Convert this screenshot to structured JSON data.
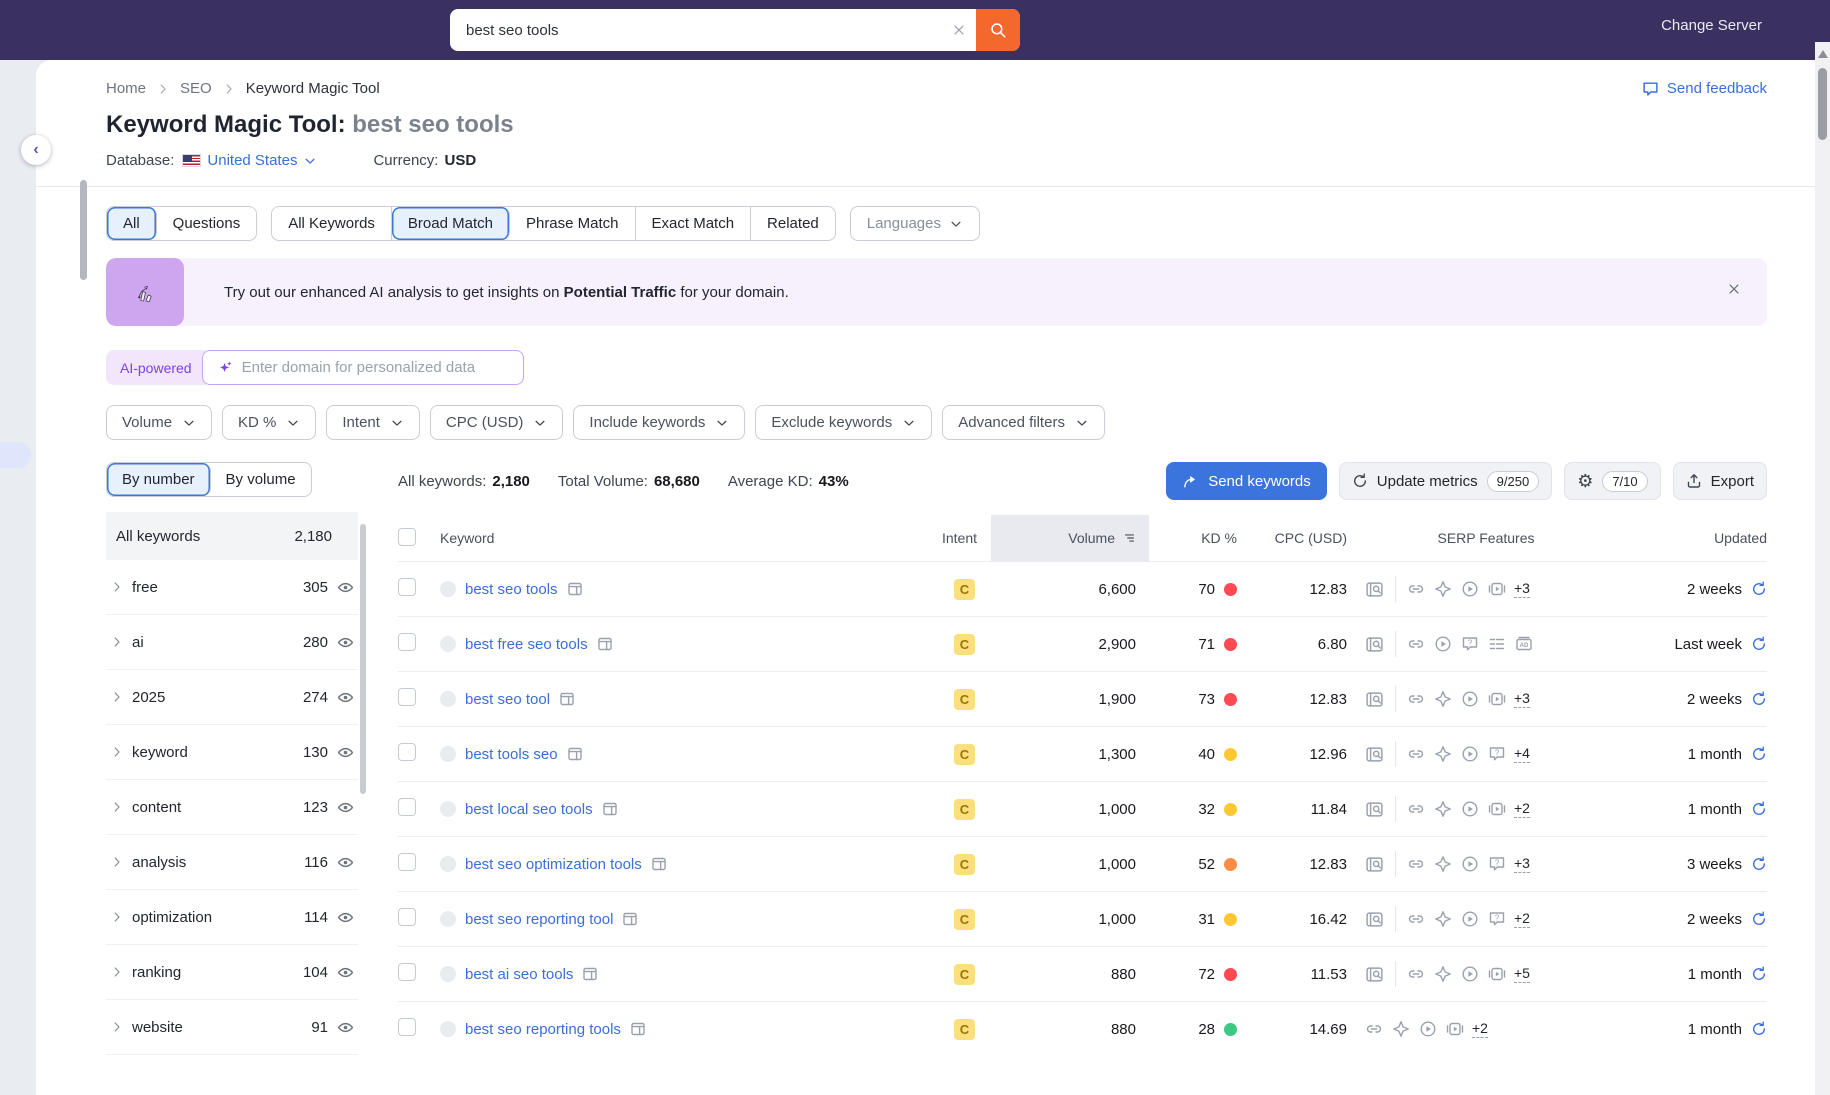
{
  "topbar": {
    "search_value": "best seo tools",
    "change_server": "Change Server"
  },
  "header": {
    "breadcrumb": [
      "Home",
      "SEO",
      "Keyword Magic Tool"
    ],
    "send_feedback": "Send feedback",
    "title": "Keyword Magic Tool:",
    "query": "best seo tools",
    "database_label": "Database:",
    "database_value": "United States",
    "currency_label": "Currency:",
    "currency_value": "USD"
  },
  "match_tabs": {
    "group1": [
      {
        "label": "All",
        "active": true
      },
      {
        "label": "Questions",
        "active": false
      }
    ],
    "group2": [
      {
        "label": "All Keywords",
        "active": false
      },
      {
        "label": "Broad Match",
        "active": true
      },
      {
        "label": "Phrase Match",
        "active": false
      },
      {
        "label": "Exact Match",
        "active": false
      },
      {
        "label": "Related",
        "active": false
      }
    ],
    "languages": "Languages"
  },
  "banner": {
    "text_before": "Try out our enhanced AI analysis to get insights on ",
    "text_bold": "Potential Traffic",
    "text_after": " for your domain."
  },
  "ai_bar": {
    "badge": "AI-powered",
    "placeholder": "Enter domain for personalized data"
  },
  "filters": [
    "Volume",
    "KD %",
    "Intent",
    "CPC (USD)",
    "Include keywords",
    "Exclude keywords",
    "Advanced filters"
  ],
  "sidebar": {
    "tabs": [
      {
        "label": "By number",
        "active": true
      },
      {
        "label": "By volume",
        "active": false
      }
    ],
    "all_label": "All keywords",
    "all_count": "2,180",
    "groups": [
      {
        "name": "free",
        "count": "305"
      },
      {
        "name": "ai",
        "count": "280"
      },
      {
        "name": "2025",
        "count": "274"
      },
      {
        "name": "keyword",
        "count": "130"
      },
      {
        "name": "content",
        "count": "123"
      },
      {
        "name": "analysis",
        "count": "116"
      },
      {
        "name": "optimization",
        "count": "114"
      },
      {
        "name": "ranking",
        "count": "104"
      },
      {
        "name": "website",
        "count": "91"
      }
    ]
  },
  "toolbar": {
    "stats": [
      {
        "label": "All keywords:",
        "value": "2,180"
      },
      {
        "label": "Total Volume:",
        "value": "68,680"
      },
      {
        "label": "Average KD:",
        "value": "43%"
      }
    ],
    "send_keywords": "Send keywords",
    "update_metrics": "Update metrics",
    "update_quota": "9/250",
    "settings_quota": "7/10",
    "export": "Export"
  },
  "table": {
    "columns": {
      "keyword": "Keyword",
      "intent": "Intent",
      "volume": "Volume",
      "kd": "KD %",
      "cpc": "CPC (USD)",
      "serp": "SERP Features",
      "updated": "Updated"
    },
    "rows": [
      {
        "keyword": "best seo tools",
        "intent": "C",
        "volume": "6,600",
        "kd": "70",
        "kd_level": "red",
        "cpc": "12.83",
        "has_preview": true,
        "serp_icons": [
          "link",
          "featured-snippet",
          "video",
          "video-carousel"
        ],
        "serp_more": "+3",
        "updated": "2 weeks"
      },
      {
        "keyword": "best free seo tools",
        "intent": "C",
        "volume": "2,900",
        "kd": "71",
        "kd_level": "red",
        "cpc": "6.80",
        "has_preview": true,
        "serp_icons": [
          "link",
          "video",
          "people-also-ask",
          "sitelinks",
          "ads"
        ],
        "serp_more": "",
        "updated": "Last week"
      },
      {
        "keyword": "best seo tool",
        "intent": "C",
        "volume": "1,900",
        "kd": "73",
        "kd_level": "red",
        "cpc": "12.83",
        "has_preview": true,
        "serp_icons": [
          "link",
          "featured-snippet",
          "video",
          "video-carousel"
        ],
        "serp_more": "+3",
        "updated": "2 weeks"
      },
      {
        "keyword": "best tools seo",
        "intent": "C",
        "volume": "1,300",
        "kd": "40",
        "kd_level": "yellow",
        "cpc": "12.96",
        "has_preview": true,
        "serp_icons": [
          "link",
          "featured-snippet",
          "video",
          "people-also-ask"
        ],
        "serp_more": "+4",
        "updated": "1 month"
      },
      {
        "keyword": "best local seo tools",
        "intent": "C",
        "volume": "1,000",
        "kd": "32",
        "kd_level": "yellow",
        "cpc": "11.84",
        "has_preview": true,
        "serp_icons": [
          "link",
          "featured-snippet",
          "video",
          "video-carousel"
        ],
        "serp_more": "+2",
        "updated": "1 month"
      },
      {
        "keyword": "best seo optimization tools",
        "intent": "C",
        "volume": "1,000",
        "kd": "52",
        "kd_level": "orange",
        "cpc": "12.83",
        "has_preview": true,
        "serp_icons": [
          "link",
          "featured-snippet",
          "video",
          "people-also-ask"
        ],
        "serp_more": "+3",
        "updated": "3 weeks"
      },
      {
        "keyword": "best seo reporting tool",
        "intent": "C",
        "volume": "1,000",
        "kd": "31",
        "kd_level": "yellow",
        "cpc": "16.42",
        "has_preview": true,
        "serp_icons": [
          "link",
          "featured-snippet",
          "video",
          "people-also-ask"
        ],
        "serp_more": "+2",
        "updated": "2 weeks"
      },
      {
        "keyword": "best ai seo tools",
        "intent": "C",
        "volume": "880",
        "kd": "72",
        "kd_level": "red",
        "cpc": "11.53",
        "has_preview": true,
        "serp_icons": [
          "link",
          "featured-snippet",
          "video",
          "video-carousel"
        ],
        "serp_more": "+5",
        "updated": "1 month"
      },
      {
        "keyword": "best seo reporting tools",
        "intent": "C",
        "volume": "880",
        "kd": "28",
        "kd_level": "green",
        "cpc": "14.69",
        "has_preview": false,
        "serp_icons": [
          "link",
          "featured-snippet",
          "video",
          "video-carousel"
        ],
        "serp_more": "+2",
        "updated": "1 month"
      }
    ]
  },
  "colors": {
    "topbar_bg": "#3a3160",
    "brand_orange": "#f4682d",
    "accent_blue": "#3a74dc",
    "link_blue": "#3a6fd8",
    "ai_purple": "#7d3ff0",
    "kd_red": "#ff4953",
    "kd_orange": "#ff8c43",
    "kd_yellow": "#ffc731",
    "kd_green": "#3cc885",
    "intent_commercial_bg": "#fbdf7d",
    "intent_commercial_text": "#9a7507"
  }
}
